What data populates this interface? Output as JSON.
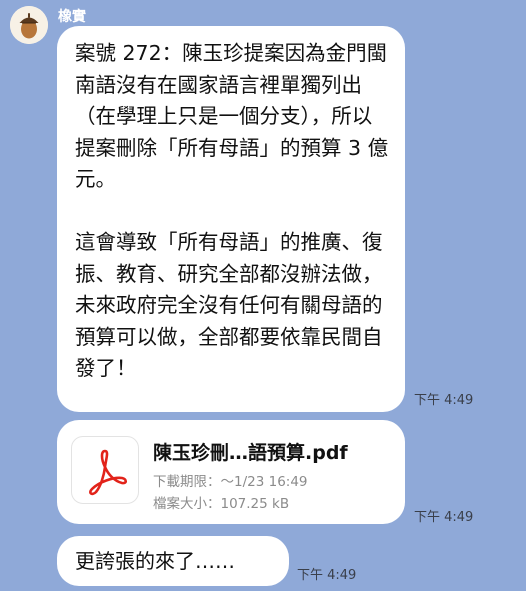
{
  "sender": {
    "name": "橡實"
  },
  "messages": [
    {
      "paragraphs": [
        "案號 272：陳玉珍提案因為金門閩南語沒有在國家語言裡單獨列出（在學理上只是一個分支），所以提案刪除「所有母語」的預算 3 億元。",
        "這會導致「所有母語」的推廣、復振、教育、研究全部都沒辦法做，未來政府完全沒有任何有關母語的預算可以做，全部都要依靠民間自發了！"
      ],
      "time": "下午 4:49"
    },
    {
      "file": {
        "name": "陳玉珍刪…語預算.pdf",
        "expiry": "下載期限：～1/23 16:49",
        "size": "檔案大小：107.25 kB",
        "icon": "pdf-icon"
      },
      "time": "下午 4:49"
    },
    {
      "text": "更誇張的來了……",
      "time": "下午 4:49"
    }
  ],
  "colors": {
    "background": "#8fa9d8",
    "bubble": "#ffffff",
    "pdf_red": "#e2231a"
  }
}
